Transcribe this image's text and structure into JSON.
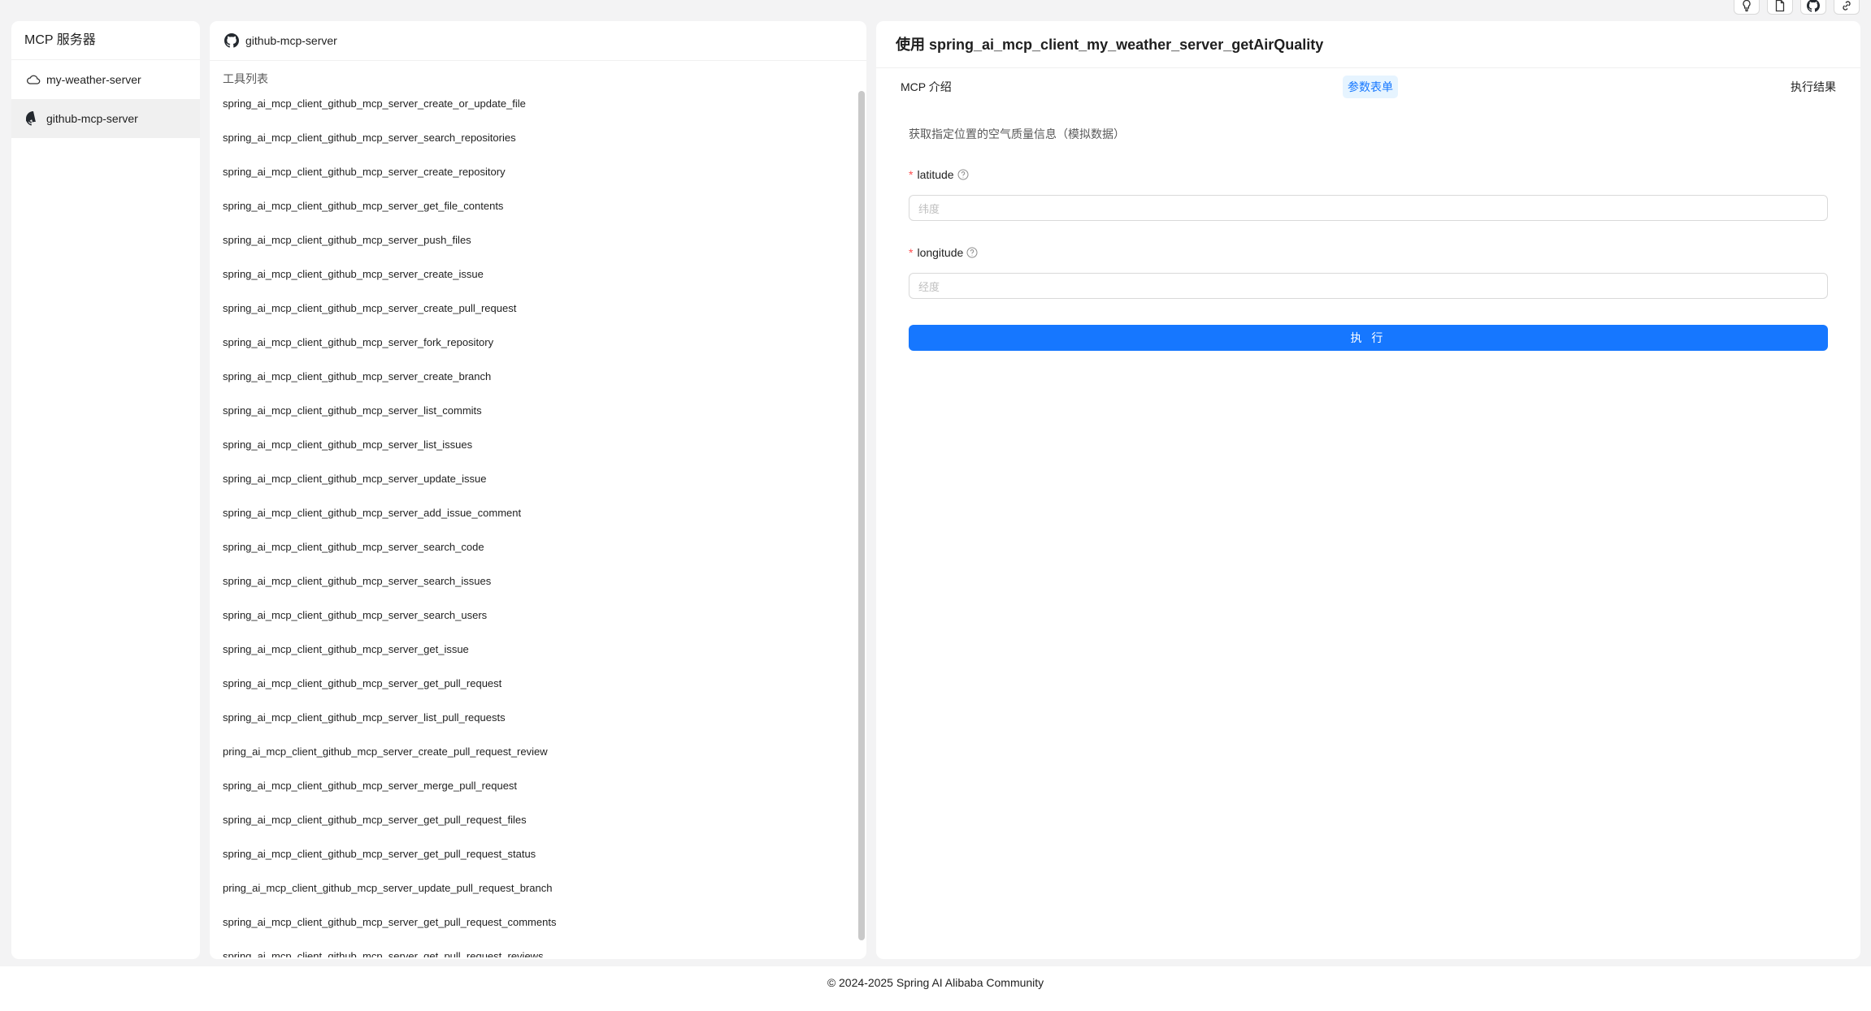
{
  "top_actions": [
    {
      "icon": "bulb-icon"
    },
    {
      "icon": "document-icon"
    },
    {
      "icon": "github-icon"
    },
    {
      "icon": "link-icon"
    }
  ],
  "servers": {
    "title": "MCP 服务器",
    "items": [
      {
        "label": "my-weather-server",
        "icon": "cloud-icon",
        "active": false
      },
      {
        "label": "github-mcp-server",
        "icon": "github-icon",
        "active": true
      }
    ]
  },
  "tools": {
    "server_name": "github-mcp-server",
    "subtitle": "工具列表",
    "items": [
      "spring_ai_mcp_client_github_mcp_server_create_or_update_file",
      "spring_ai_mcp_client_github_mcp_server_search_repositories",
      "spring_ai_mcp_client_github_mcp_server_create_repository",
      "spring_ai_mcp_client_github_mcp_server_get_file_contents",
      "spring_ai_mcp_client_github_mcp_server_push_files",
      "spring_ai_mcp_client_github_mcp_server_create_issue",
      "spring_ai_mcp_client_github_mcp_server_create_pull_request",
      "spring_ai_mcp_client_github_mcp_server_fork_repository",
      "spring_ai_mcp_client_github_mcp_server_create_branch",
      "spring_ai_mcp_client_github_mcp_server_list_commits",
      "spring_ai_mcp_client_github_mcp_server_list_issues",
      "spring_ai_mcp_client_github_mcp_server_update_issue",
      "spring_ai_mcp_client_github_mcp_server_add_issue_comment",
      "spring_ai_mcp_client_github_mcp_server_search_code",
      "spring_ai_mcp_client_github_mcp_server_search_issues",
      "spring_ai_mcp_client_github_mcp_server_search_users",
      "spring_ai_mcp_client_github_mcp_server_get_issue",
      "spring_ai_mcp_client_github_mcp_server_get_pull_request",
      "spring_ai_mcp_client_github_mcp_server_list_pull_requests",
      "pring_ai_mcp_client_github_mcp_server_create_pull_request_review",
      "spring_ai_mcp_client_github_mcp_server_merge_pull_request",
      "spring_ai_mcp_client_github_mcp_server_get_pull_request_files",
      "spring_ai_mcp_client_github_mcp_server_get_pull_request_status",
      "pring_ai_mcp_client_github_mcp_server_update_pull_request_branch",
      "spring_ai_mcp_client_github_mcp_server_get_pull_request_comments",
      "spring_ai_mcp_client_github_mcp_server_get_pull_request_reviews"
    ]
  },
  "detail": {
    "title": "使用 spring_ai_mcp_client_my_weather_server_getAirQuality",
    "tabs": {
      "intro": "MCP 介绍",
      "params": "参数表单",
      "result": "执行结果"
    },
    "description": "获取指定位置的空气质量信息（模拟数据）",
    "fields": [
      {
        "label": "latitude",
        "required_mark": "*",
        "placeholder": "纬度"
      },
      {
        "label": "longitude",
        "required_mark": "*",
        "placeholder": "经度"
      }
    ],
    "execute_label": "执 行"
  },
  "footer": {
    "text": "© 2024-2025 Spring AI Alibaba Community"
  }
}
